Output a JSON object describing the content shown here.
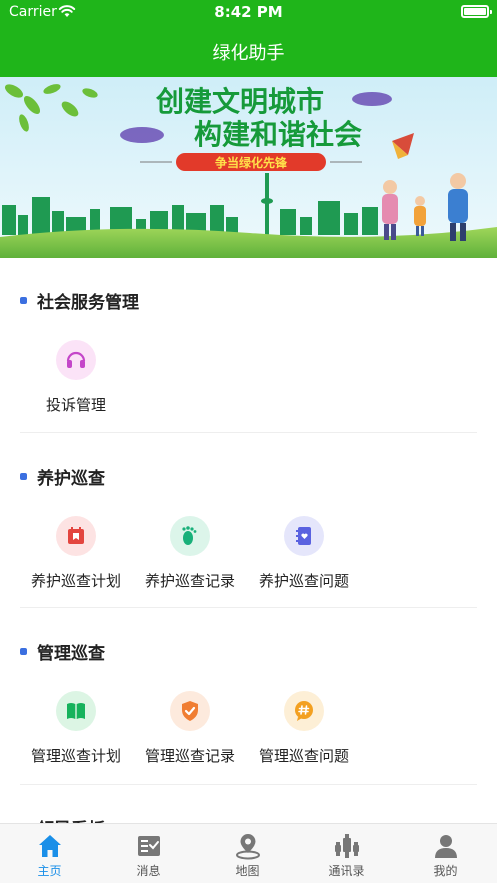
{
  "status_bar": {
    "carrier": "Carrier",
    "time": "8:42 PM"
  },
  "nav": {
    "title": "绿化助手"
  },
  "banner": {
    "headline1": "创建文明城市",
    "headline2": "构建和谐社会",
    "slogan": "争当绿化先锋"
  },
  "sections": [
    {
      "title": "社会服务管理",
      "items": [
        {
          "label": "投诉管理",
          "icon": "headset-icon"
        }
      ]
    },
    {
      "title": "养护巡查",
      "items": [
        {
          "label": "养护巡查计划",
          "icon": "calendar-bookmark-icon"
        },
        {
          "label": "养护巡查记录",
          "icon": "footprint-icon"
        },
        {
          "label": "养护巡查问题",
          "icon": "heart-book-icon"
        }
      ]
    },
    {
      "title": "管理巡查",
      "items": [
        {
          "label": "管理巡查计划",
          "icon": "open-book-icon"
        },
        {
          "label": "管理巡查记录",
          "icon": "shield-check-icon"
        },
        {
          "label": "管理巡查问题",
          "icon": "hashtag-chat-icon"
        }
      ]
    },
    {
      "title": "领导看板"
    }
  ],
  "tabbar": {
    "items": [
      {
        "label": "主页",
        "icon": "home-icon",
        "active": true
      },
      {
        "label": "消息",
        "icon": "message-list-icon",
        "active": false
      },
      {
        "label": "地图",
        "icon": "map-pin-icon",
        "active": false
      },
      {
        "label": "通讯录",
        "icon": "contacts-icon",
        "active": false
      },
      {
        "label": "我的",
        "icon": "profile-icon",
        "active": false
      }
    ]
  },
  "colors": {
    "primary_green": "#1fb51a",
    "accent_blue": "#1a8fe8",
    "section_dot": "#3b6fe0"
  }
}
